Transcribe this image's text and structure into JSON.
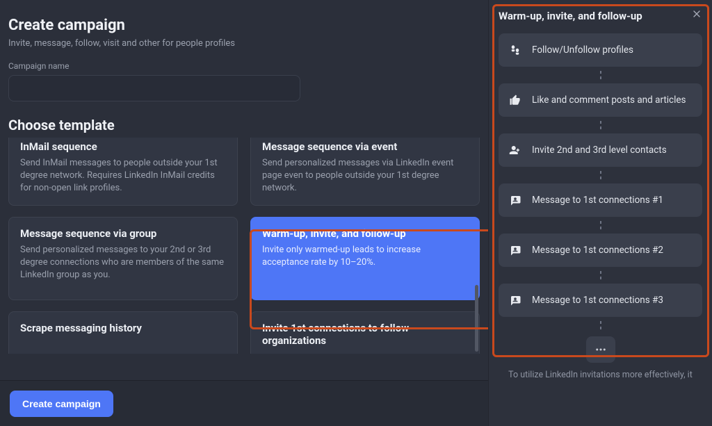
{
  "header": {
    "title": "Create campaign",
    "subtitle": "Invite, message, follow, visit and other for people profiles"
  },
  "form": {
    "name_label": "Campaign name",
    "name_value": ""
  },
  "templates_header": "Choose template",
  "templates": {
    "inmail": {
      "title": "InMail sequence",
      "desc": "Send InMail messages to people outside your 1st degree network. Requires LinkedIn InMail credits for non-open link profiles."
    },
    "msg_event": {
      "title": "Message sequence via event",
      "desc": "Send personalized messages via LinkedIn event page even to people outside your 1st degree network."
    },
    "msg_group": {
      "title": "Message sequence via group",
      "desc": "Send personalized messages to your 2nd or 3rd degree connections who are members of the same LinkedIn group as you."
    },
    "warmup": {
      "title": "Warm-up, invite, and follow-up",
      "desc": "Invite only warmed-up leads to increase acceptance rate by 10–20%."
    },
    "scrape": {
      "title": "Scrape messaging history",
      "desc": ""
    },
    "invite_org": {
      "title": "Invite 1st connections to follow organizations",
      "desc": ""
    }
  },
  "footer": {
    "create_label": "Create campaign"
  },
  "panel": {
    "title": "Warm-up, invite, and follow-up",
    "steps": [
      {
        "icon": "footsteps",
        "label": "Follow/Unfollow profiles"
      },
      {
        "icon": "thumbs-up",
        "label": "Like and comment posts and articles"
      },
      {
        "icon": "person-plus",
        "label": "Invite 2nd and 3rd level contacts"
      },
      {
        "icon": "chat-person",
        "label": "Message to 1st connections #1"
      },
      {
        "icon": "chat-person",
        "label": "Message to 1st connections #2"
      },
      {
        "icon": "chat-person",
        "label": "Message to 1st connections #3"
      }
    ],
    "footer_text": "To utilize LinkedIn invitations more effectively, it"
  }
}
